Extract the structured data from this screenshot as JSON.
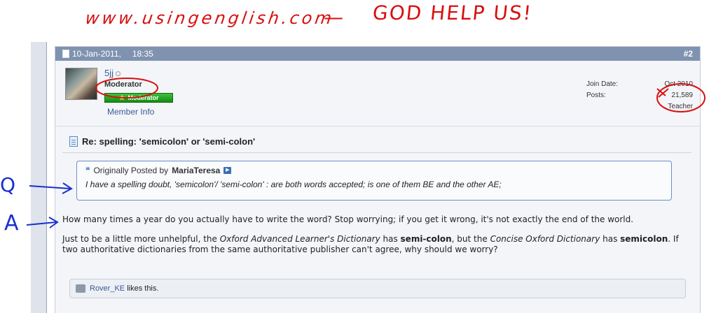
{
  "annotations": {
    "site": "www.usingenglish.com",
    "dash": "—",
    "reaction": "GOD HELP US!",
    "q_label": "Q",
    "a_label": "A"
  },
  "post": {
    "date": "10-Jan-2011,",
    "time": "18:35",
    "number": "#2",
    "user": {
      "name": "5jj",
      "title": "Moderator",
      "rank_badge": "Moderator",
      "member_info": "Member Info"
    },
    "stats": {
      "join_date_label": "Join Date:",
      "join_date": "Oct 2010",
      "posts_label": "Posts:",
      "posts": "21,589",
      "role": "Teacher"
    },
    "title": "Re: spelling: 'semicolon' or 'semi-colon'",
    "quote": {
      "intro": "Originally Posted by",
      "author": "MariaTeresa",
      "text": "I have a spelling doubt, 'semicolon'/ 'semi-colon' : are both words accepted; is one of them BE and the other AE;"
    },
    "body": {
      "p1": "How many times a year do you actually have to write the word? Stop worrying; if you get it wrong, it's not exactly the end of the world.",
      "p2_a": "Just to be a little more unhelpful, the ",
      "p2_b": "Oxford Advanced Learner's Dictionary",
      "p2_c": " has ",
      "p2_d": "semi-colon",
      "p2_e": ", but the ",
      "p2_f": "Concise Oxford Dictionary",
      "p2_g": " has ",
      "p2_h": "semicolon",
      "p2_i": ". If two authoritative dictionaries from the same authoritative publisher can't agree, why should we worry?"
    },
    "likes": {
      "user": "Rover_KE",
      "text": " likes this."
    }
  },
  "colors": {
    "header": "#7f93b0",
    "annotation_red": "#d80f0f",
    "annotation_blue": "#1a2fd0",
    "link": "#3a5a99"
  }
}
